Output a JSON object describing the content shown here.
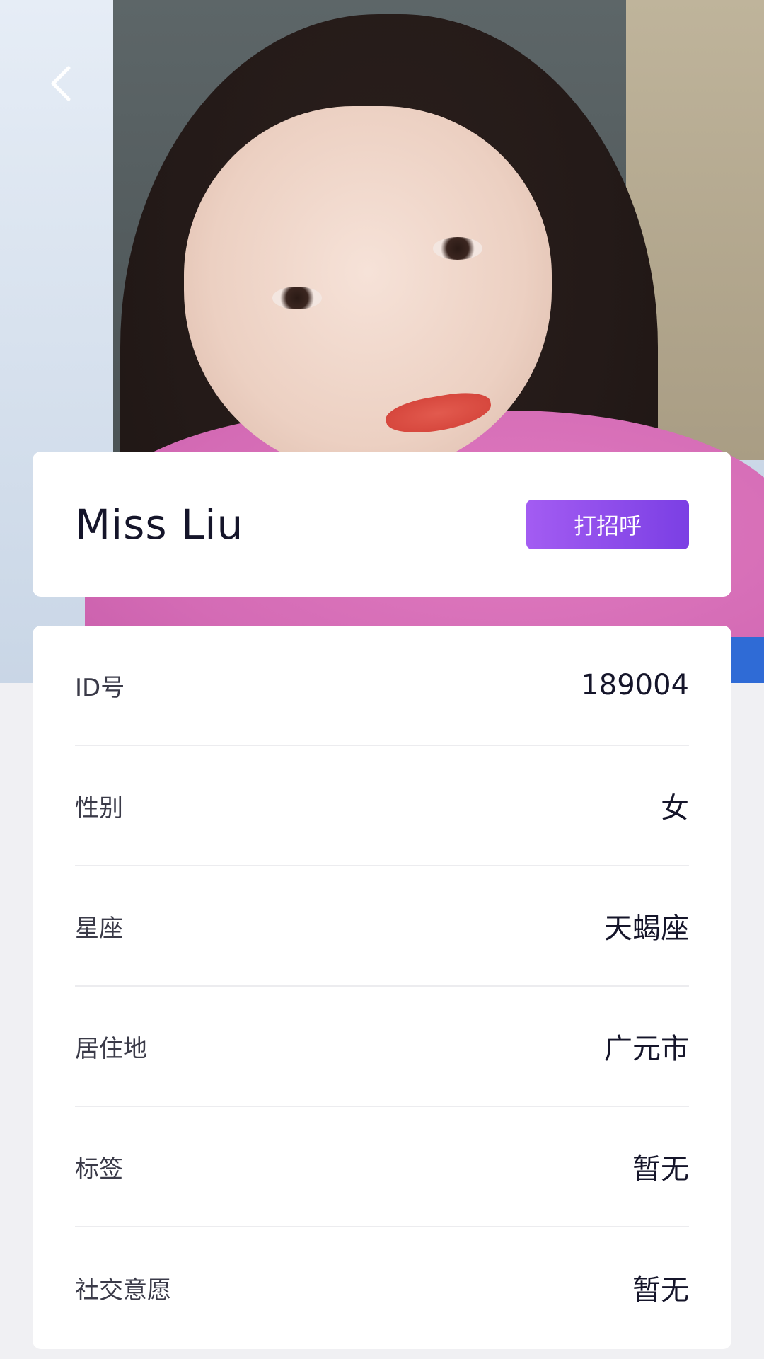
{
  "profile": {
    "name": "Miss Liu",
    "greet_button": "打招呼"
  },
  "details": [
    {
      "label": "ID号",
      "value": "189004"
    },
    {
      "label": "性别",
      "value": "女"
    },
    {
      "label": "星座",
      "value": "天蝎座"
    },
    {
      "label": "居住地",
      "value": "广元市"
    },
    {
      "label": "标签",
      "value": "暂无"
    },
    {
      "label": "社交意愿",
      "value": "暂无"
    }
  ],
  "icons": {
    "back": "chevron-left-icon"
  },
  "colors": {
    "accent_start": "#a35cf2",
    "accent_end": "#7b3fe4",
    "background": "#f0f0f3",
    "text_primary": "#15152a",
    "text_secondary": "#3a3a48"
  }
}
